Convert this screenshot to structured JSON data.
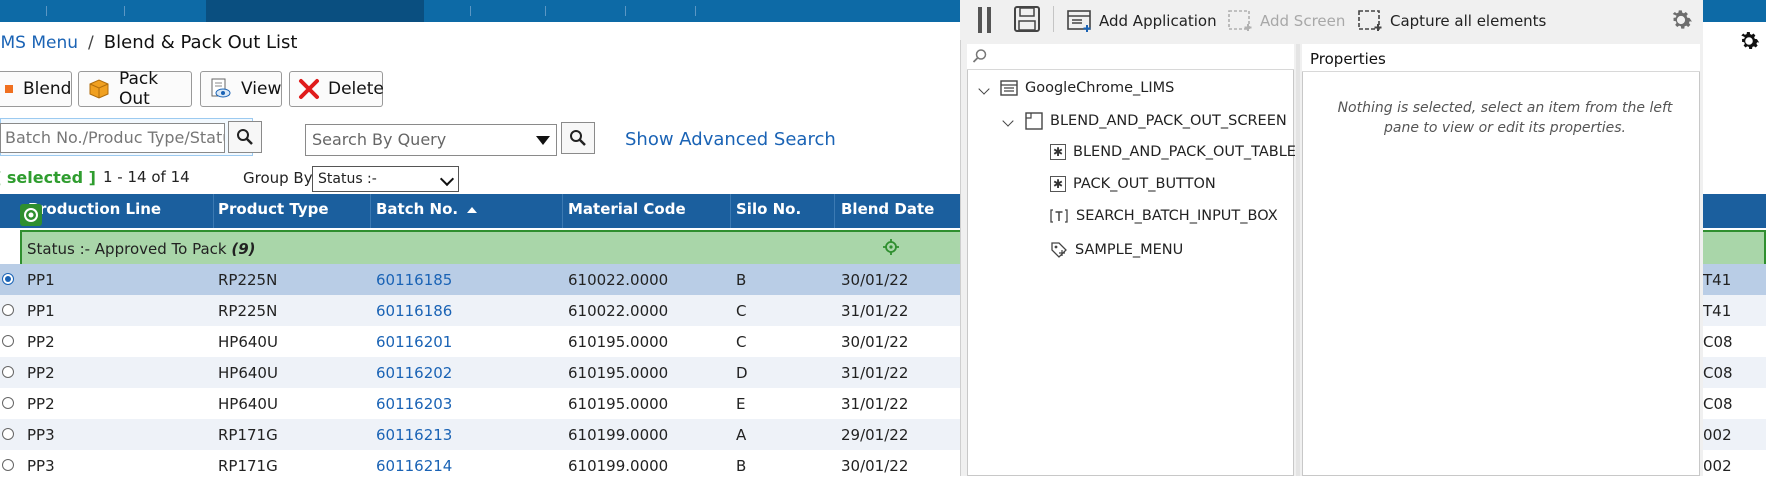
{
  "breadcrumb": {
    "parent": "LIMS Menu",
    "separator": "/",
    "current": "Blend & Pack Out List"
  },
  "toolbar": {
    "blend_label": "Blend",
    "packout_label": "Pack Out",
    "view_label": "View",
    "delete_label": "Delete"
  },
  "search": {
    "batch_placeholder": "Batch No./Produc Type/Status/M",
    "query_placeholder": "Search By Query",
    "advanced_label": "Show Advanced Search"
  },
  "status_bar": {
    "selected_label": "[ selected ]",
    "range_label": "1 - 14 of 14",
    "group_by_label": "Group By",
    "group_by_value": "Status :-"
  },
  "table": {
    "columns": [
      "Production Line",
      "Product Type",
      "Batch No.",
      "Material Code",
      "Silo No.",
      "Blend Date"
    ],
    "group": {
      "label": "Status :- Approved To Pack",
      "count": "(9)"
    },
    "rows": [
      {
        "line": "PP1",
        "type": "RP225N",
        "batch": "60116185",
        "material": "610022.0000",
        "silo": "B",
        "date": "30/01/22",
        "tail": "T41",
        "selected": true
      },
      {
        "line": "PP1",
        "type": "RP225N",
        "batch": "60116186",
        "material": "610022.0000",
        "silo": "C",
        "date": "31/01/22",
        "tail": "T41",
        "selected": false
      },
      {
        "line": "PP2",
        "type": "HP640U",
        "batch": "60116201",
        "material": "610195.0000",
        "silo": "C",
        "date": "30/01/22",
        "tail": "C08",
        "selected": false
      },
      {
        "line": "PP2",
        "type": "HP640U",
        "batch": "60116202",
        "material": "610195.0000",
        "silo": "D",
        "date": "31/01/22",
        "tail": "C08",
        "selected": false
      },
      {
        "line": "PP2",
        "type": "HP640U",
        "batch": "60116203",
        "material": "610195.0000",
        "silo": "E",
        "date": "31/01/22",
        "tail": "C08",
        "selected": false
      },
      {
        "line": "PP3",
        "type": "RP171G",
        "batch": "60116213",
        "material": "610199.0000",
        "silo": "A",
        "date": "29/01/22",
        "tail": "002",
        "selected": false
      },
      {
        "line": "PP3",
        "type": "RP171G",
        "batch": "60116214",
        "material": "610199.0000",
        "silo": "B",
        "date": "30/01/22",
        "tail": "002",
        "selected": false
      }
    ]
  },
  "inspector": {
    "add_application": "Add Application",
    "add_screen": "Add Screen",
    "capture_all": "Capture all elements",
    "properties_title": "Properties",
    "empty_message": "Nothing is selected, select an item from the left pane to view or edit its properties.",
    "tree": {
      "app": "GoogleChrome_LIMS",
      "screen": "BLEND_AND_PACK_OUT_SCREEN",
      "elements": [
        "BLEND_AND_PACK_OUT_TABLE",
        "PACK_OUT_BUTTON",
        "SEARCH_BATCH_INPUT_BOX",
        "SAMPLE_MENU"
      ]
    }
  },
  "colors": {
    "nav": "#0d6aa6",
    "table_header": "#1b5f9e",
    "group_row": "#a9d6a9",
    "link": "#1a63b5"
  }
}
